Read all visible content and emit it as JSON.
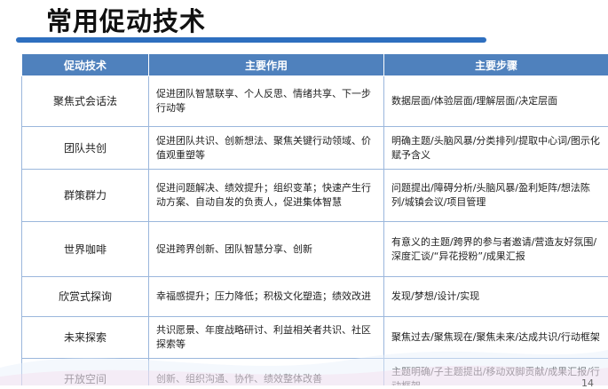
{
  "title": "常用促动技术",
  "table": {
    "headers": [
      "促动技术",
      "主要作用",
      "主要步骤"
    ],
    "rows": [
      {
        "tech": "聚焦式会话法",
        "effect": "促进团队智慧联享、个人反思、情绪共享、下一步行动等",
        "steps": "数据层面/体验层面/理解层面/决定层面"
      },
      {
        "tech": "团队共创",
        "effect": "促进团队共识、创新想法、聚焦关键行动领域、价值观重塑等",
        "steps": "明确主题/头脑风暴/分类排列/提取中心词/图示化赋予含义"
      },
      {
        "tech": "群策群力",
        "effect": "促进问题解决、绩效提升；组织变革；快速产生行动方案、自动自发的负责人，促进集体智慧",
        "steps": "问题提出/障碍分析/头脑风暴/盈利矩阵/想法陈列/城镇会议/项目管理"
      },
      {
        "tech": "世界咖啡",
        "effect": "促进跨界创新、团队智慧分享、创新",
        "steps": "有意义的主题/跨界的参与者邀请/营造友好氛围/深度汇谈/“异花授粉”/成果汇报"
      },
      {
        "tech": "欣赏式探询",
        "effect": "幸福感提升；压力降低；积极文化塑造；绩效改进",
        "steps": "发现/梦想/设计/实现"
      },
      {
        "tech": "未来探索",
        "effect": "共识愿景、年度战略研讨、利益相关者共识、社区探索等",
        "steps": "聚焦过去/聚焦现在/聚焦未来/达成共识/行动框架"
      },
      {
        "tech": "开放空间",
        "effect": "创新、组织沟通、协作、绩效整体改善",
        "steps": "主题明确/子主题提出/移动双脚贡献/成果汇报/行动框架"
      }
    ]
  },
  "page_number": "14"
}
